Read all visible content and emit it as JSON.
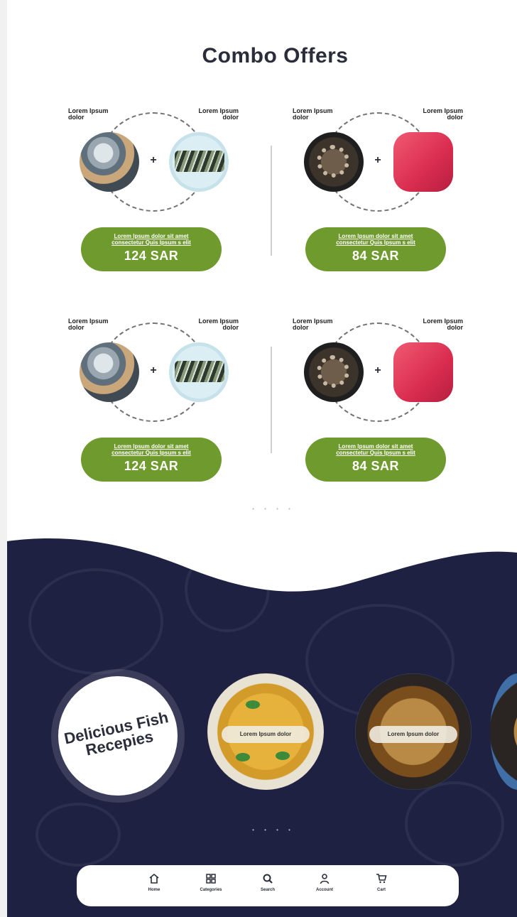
{
  "title": "Combo Offers",
  "combos": [
    {
      "left_label": "Lorem Ipsum dolor",
      "right_label": "Lorem Ipsum dolor",
      "left_icon": "fish-icon",
      "right_icon": "sardine-icon",
      "desc": "Lorem Ipsum dolor sit amet consectetur Quis Ipsum s elit",
      "price": "124 SAR"
    },
    {
      "left_label": "Lorem Ipsum dolor",
      "right_label": "Lorem Ipsum dolor",
      "left_icon": "shrimp-icon",
      "right_icon": "tuna-icon",
      "desc": "Lorem Ipsum dolor sit amet consectetur Quis Ipsum s elit",
      "price": "84 SAR"
    },
    {
      "left_label": "Lorem Ipsum dolor",
      "right_label": "Lorem Ipsum dolor",
      "left_icon": "fish-icon",
      "right_icon": "sardine-icon",
      "desc": "Lorem Ipsum dolor sit amet consectetur Quis Ipsum s elit",
      "price": "124 SAR"
    },
    {
      "left_label": "Lorem Ipsum dolor",
      "right_label": "Lorem Ipsum dolor",
      "left_icon": "shrimp-icon",
      "right_icon": "tuna-icon",
      "desc": "Lorem Ipsum dolor sit amet consectetur Quis Ipsum s elit",
      "price": "84 SAR"
    }
  ],
  "combo_pager_dots": "• • • •",
  "recipes": {
    "badge": "Delicious Fish Recepies",
    "items": [
      {
        "label": "Lorem Ipsum dolor"
      },
      {
        "label": "Lorem Ipsum dolor"
      }
    ],
    "pager_dots": "• • • •"
  },
  "nav": {
    "items": [
      {
        "label": "Home",
        "icon": "home-icon"
      },
      {
        "label": "Categories",
        "icon": "grid-icon"
      },
      {
        "label": "Search",
        "icon": "search-icon"
      },
      {
        "label": "Account",
        "icon": "user-icon"
      },
      {
        "label": "Cart",
        "icon": "cart-icon"
      }
    ]
  },
  "colors": {
    "pill_green": "#6f9a2d",
    "dark_navy": "#1f2142",
    "title_text": "#2b2d3a"
  }
}
